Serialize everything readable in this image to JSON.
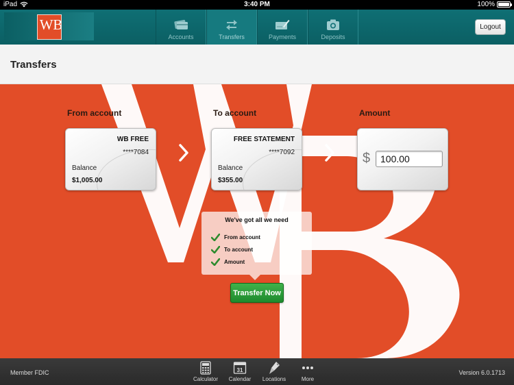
{
  "status_bar": {
    "device": "iPad",
    "time": "3:40 PM",
    "battery": "100%",
    "icons": [
      "wifi-icon",
      "battery-icon"
    ]
  },
  "header": {
    "logo": "WB",
    "nav": [
      {
        "label": "Accounts",
        "icon": "cards-icon"
      },
      {
        "label": "Transfers",
        "icon": "transfer-arrows-icon",
        "active": true
      },
      {
        "label": "Payments",
        "icon": "check-pen-icon"
      },
      {
        "label": "Deposits",
        "icon": "camera-icon"
      }
    ],
    "logout_label": "Logout"
  },
  "page": {
    "title": "Transfers"
  },
  "transfer": {
    "from_label": "From account",
    "to_label": "To account",
    "amount_label": "Amount",
    "from_account": {
      "name": "WB FREE",
      "number": "****7084",
      "balance_label": "Balance",
      "balance": "$1,005.00"
    },
    "to_account": {
      "name": "FREE STATEMENT",
      "number": "****7092",
      "balance_label": "Balance",
      "balance": "$355.00"
    },
    "currency_symbol": "$",
    "amount_value": "100.00",
    "checklist": {
      "title": "We've got all we need",
      "items": [
        "From account",
        "To account",
        "Amount"
      ]
    },
    "submit_label": "Transfer Now"
  },
  "footer": {
    "left": "Member FDIC",
    "right": "Version 6.0.1713",
    "tools": [
      {
        "label": "Calculator",
        "icon": "calculator-icon"
      },
      {
        "label": "Calendar",
        "icon": "calendar-icon",
        "day": "31"
      },
      {
        "label": "Locations",
        "icon": "map-pin-icon"
      },
      {
        "label": "More",
        "icon": "more-dots-icon"
      }
    ]
  },
  "colors": {
    "brand_teal": "#0f6f74",
    "brand_orange": "#e24d28",
    "action_green": "#2e9d3b"
  }
}
